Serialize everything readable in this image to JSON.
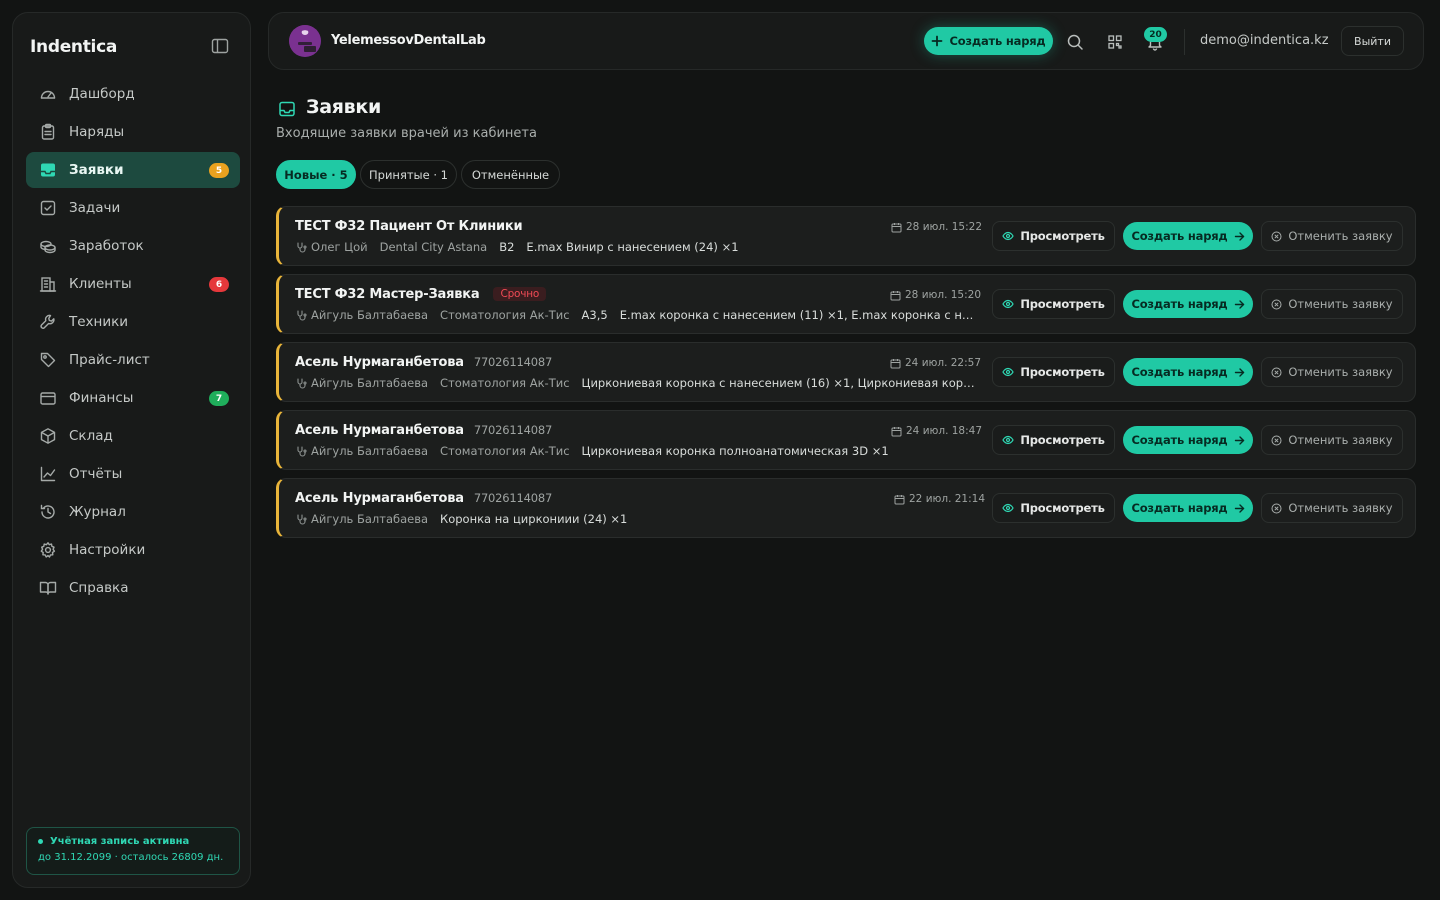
{
  "app": {
    "brand": "Indentica"
  },
  "colors": {
    "accent": "#20c9a4",
    "warning": "#e9b53a",
    "danger": "#ef4a55",
    "background": "#121413"
  },
  "sidebar": {
    "items": [
      {
        "label": "Дашборд",
        "icon": "gauge-icon"
      },
      {
        "label": "Наряды",
        "icon": "clipboard-icon"
      },
      {
        "label": "Заявки",
        "icon": "inbox-icon",
        "active": true,
        "badge": "5",
        "badge_color": "#e9a21f"
      },
      {
        "label": "Задачи",
        "icon": "checkbox-icon"
      },
      {
        "label": "Заработок",
        "icon": "coins-icon"
      },
      {
        "label": "Клиенты",
        "icon": "building-icon",
        "badge": "6",
        "badge_color": "#e5383b"
      },
      {
        "label": "Техники",
        "icon": "wrench-icon"
      },
      {
        "label": "Прайс-лист",
        "icon": "tag-icon"
      },
      {
        "label": "Финансы",
        "icon": "wallet-icon",
        "badge": "7",
        "badge_color": "#1fae5b"
      },
      {
        "label": "Склад",
        "icon": "package-icon"
      },
      {
        "label": "Отчёты",
        "icon": "chart-line-icon"
      },
      {
        "label": "Журнал",
        "icon": "history-icon"
      },
      {
        "label": "Настройки",
        "icon": "gear-icon"
      },
      {
        "label": "Справка",
        "icon": "book-icon"
      }
    ],
    "account": {
      "status": "Учётная запись активна",
      "details": "до 31.12.2099 · осталось 26809 дн."
    }
  },
  "topbar": {
    "lab_name": "YelemessovDentalLab",
    "create_label": "Создать наряд",
    "notifications_count": "20",
    "email": "demo@indentica.kz",
    "logout_label": "Выйти"
  },
  "page": {
    "title": "Заявки",
    "subtitle": "Входящие заявки врачей из кабинета",
    "tabs": [
      {
        "label": "Новые · 5",
        "active": true
      },
      {
        "label": "Принятые · 1"
      },
      {
        "label": "Отменённые"
      }
    ]
  },
  "actions": {
    "view": "Просмотреть",
    "create": "Создать наряд",
    "cancel": "Отменить заявку"
  },
  "requests": [
    {
      "patient": "ТЕСТ Ф32 Пациент От Клиники",
      "phone": "",
      "urgent": "",
      "doctor": "Олег Цой",
      "clinic": "Dental City Astana",
      "shade": "B2",
      "items": "E.max Винир с нанесением (24) ×1",
      "date": "28 июл. 15:22"
    },
    {
      "patient": "ТЕСТ Ф32 Мастер-Заявка",
      "phone": "",
      "urgent": "Срочно",
      "doctor": "Айгуль Балтабаева",
      "clinic": "Стоматология Ак-Тис",
      "shade": "A3,5",
      "items": "E.max коронка с нанесением (11) ×1, E.max коронка с нанесен...",
      "date": "28 июл. 15:20"
    },
    {
      "patient": "Асель Нурмаганбетова",
      "phone": "77026114087",
      "urgent": "",
      "doctor": "Айгуль Балтабаева",
      "clinic": "Стоматология Ак-Тис",
      "shade": "",
      "items": "Циркониевая коронка с нанесением (16) ×1, Циркониевая коронка с ...",
      "date": "24 июл. 22:57"
    },
    {
      "patient": "Асель Нурмаганбетова",
      "phone": "77026114087",
      "urgent": "",
      "doctor": "Айгуль Балтабаева",
      "clinic": "Стоматология Ак-Тис",
      "shade": "",
      "items": "Циркониевая коронка полноанатомическая 3D ×1",
      "date": "24 июл. 18:47"
    },
    {
      "patient": "Асель Нурмаганбетова",
      "phone": "77026114087",
      "urgent": "",
      "doctor": "Айгуль Балтабаева",
      "clinic": "",
      "shade": "",
      "items": "Коронка на циркониии (24) ×1",
      "date": "22 июл. 21:14"
    }
  ]
}
